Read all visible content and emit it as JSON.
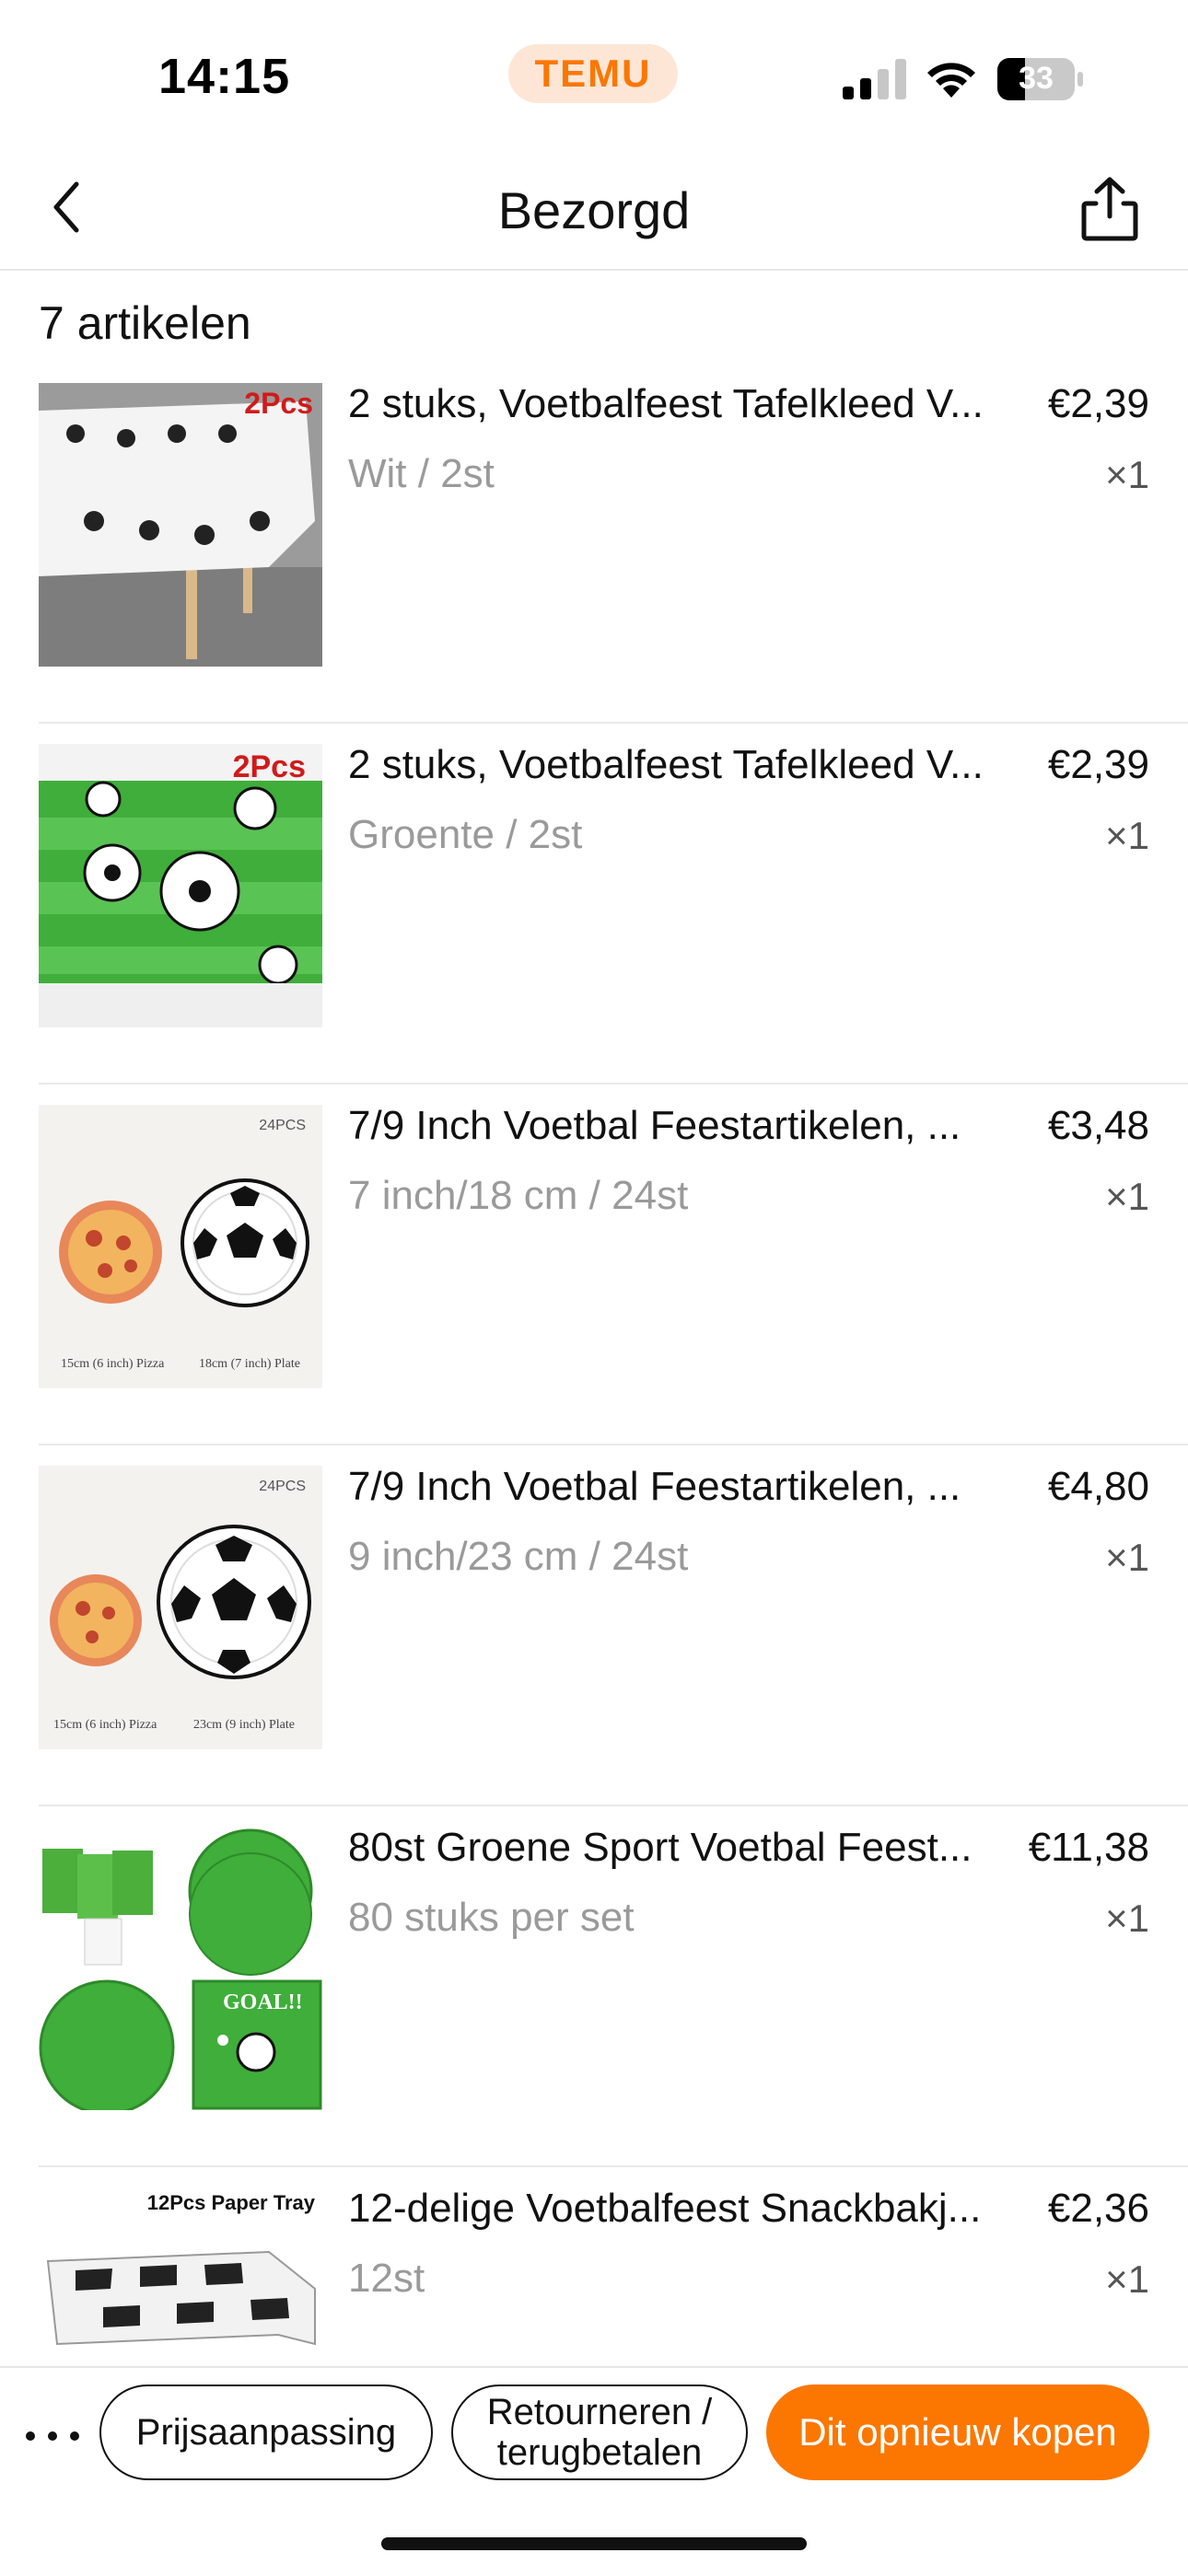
{
  "status_bar": {
    "time": "14:15",
    "app_badge": "TEMU",
    "battery_level": "33",
    "icons": [
      "signal-icon",
      "wifi-icon",
      "battery-icon"
    ]
  },
  "header": {
    "title": "Bezorgd",
    "back_icon": "chevron-left-icon",
    "share_icon": "share-icon"
  },
  "summary": {
    "count_label": "7 artikelen"
  },
  "items": [
    {
      "name": "2 stuks, Voetbalfeest Tafelkleed V...",
      "variant": "Wit / 2st",
      "price": "€2,39",
      "qty": "×1",
      "thumb_badge": "2Pcs"
    },
    {
      "name": "2 stuks, Voetbalfeest Tafelkleed V...",
      "variant": "Groente / 2st",
      "price": "€2,39",
      "qty": "×1",
      "thumb_badge": "2Pcs"
    },
    {
      "name": "7/9 Inch Voetbal Feestartikelen, ...",
      "variant": "7 inch/18 cm / 24st",
      "price": "€3,48",
      "qty": "×1",
      "thumb_badge": "24PCS",
      "thumb_caption_left": "15cm (6 inch) Pizza",
      "thumb_caption_right": "18cm (7 inch) Plate"
    },
    {
      "name": "7/9 Inch Voetbal Feestartikelen, ...",
      "variant": "9 inch/23 cm / 24st",
      "price": "€4,80",
      "qty": "×1",
      "thumb_badge": "24PCS",
      "thumb_caption_left": "15cm (6 inch) Pizza",
      "thumb_caption_right": "23cm (9 inch) Plate"
    },
    {
      "name": "80st Groene Sport Voetbal Feest...",
      "variant": "80 stuks per set",
      "price": "€11,38",
      "qty": "×1",
      "thumb_badge": "GOAL!!"
    },
    {
      "name": "12-delige Voetbalfeest Snackbakj...",
      "variant": "12st",
      "price": "€2,36",
      "qty": "×1",
      "thumb_badge": "12Pcs Paper Tray"
    }
  ],
  "actions": {
    "more_icon": "more-dots-icon",
    "price_adjust": "Prijsaanpassing",
    "return_line1": "Retourneren /",
    "return_line2": "terugbetalen",
    "buy_again": "Dit opnieuw kopen"
  },
  "colors": {
    "accent": "#fb7701",
    "temu_pill_bg": "#fde6d6",
    "muted_text": "#9a9a9a",
    "divider": "#e9e9e9",
    "field_green": "#3fae3a"
  }
}
